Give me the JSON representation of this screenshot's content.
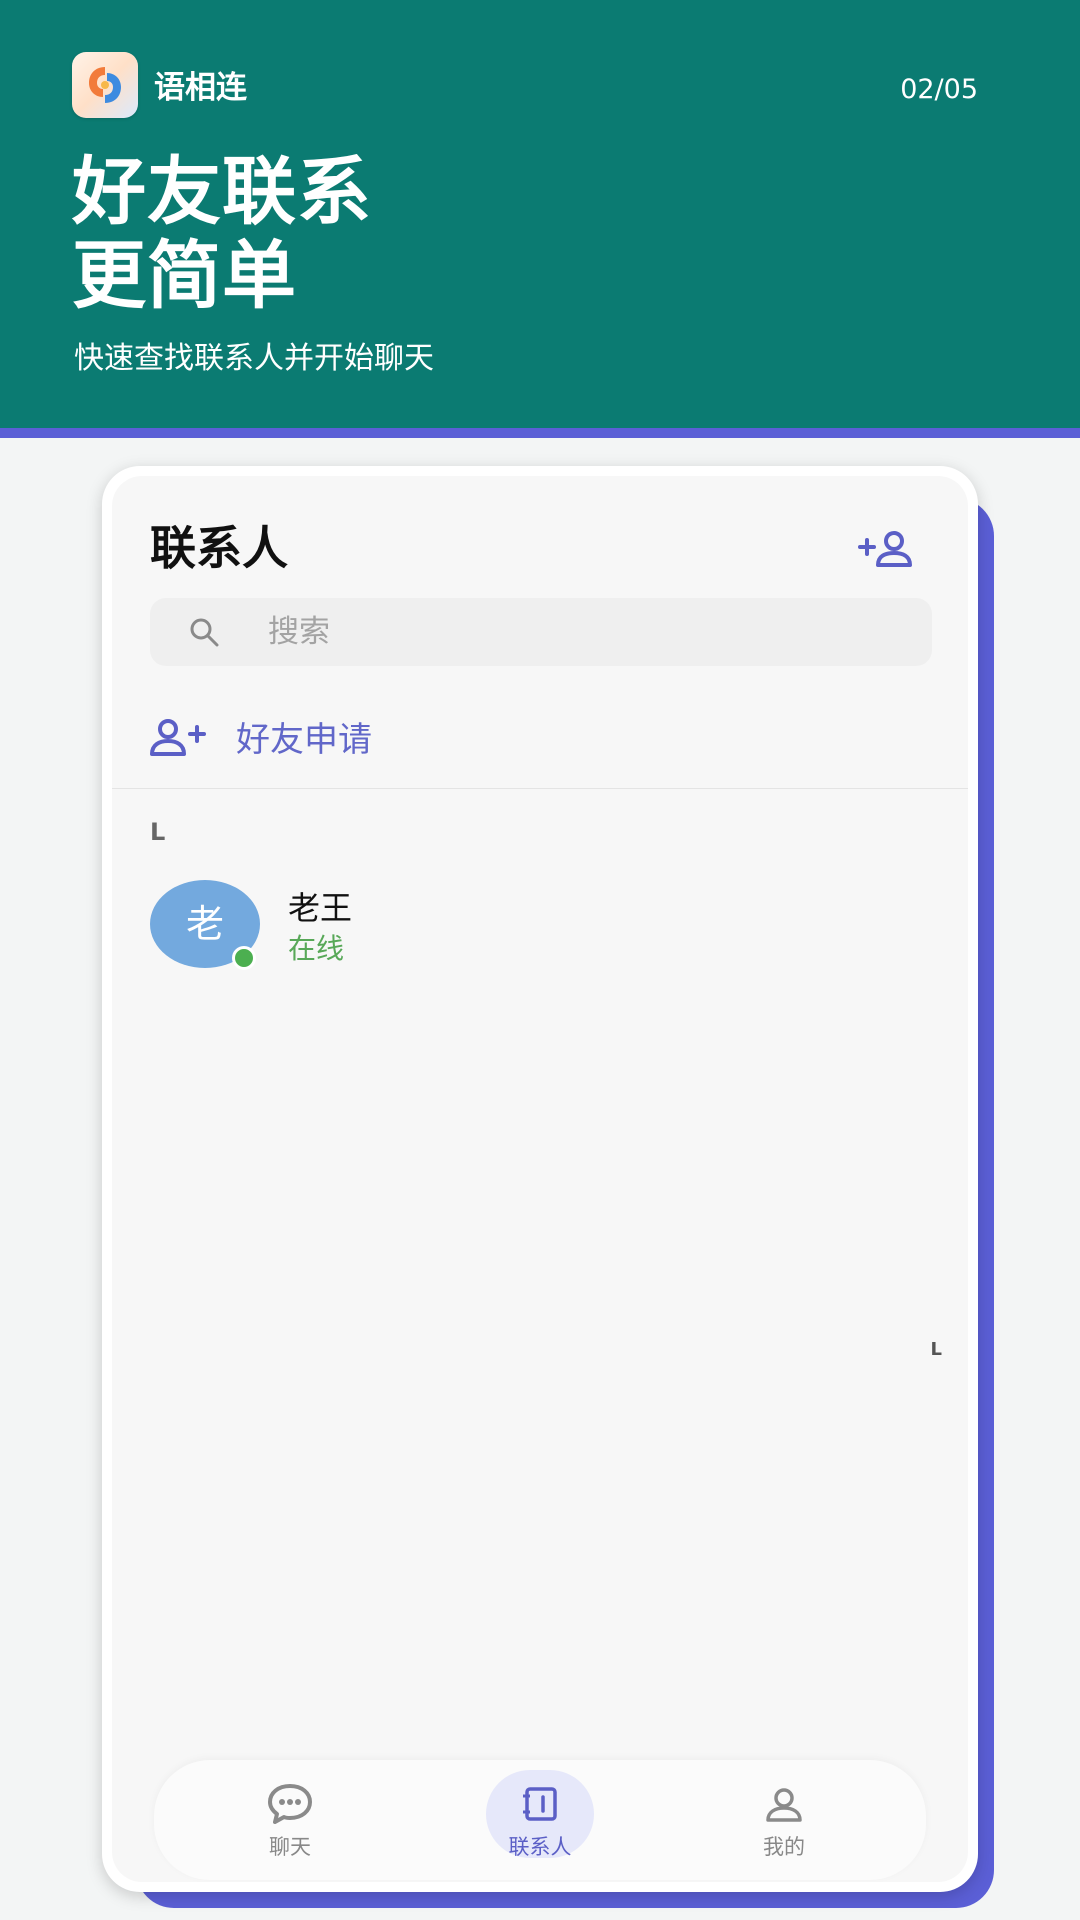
{
  "header": {
    "app_name": "语相连",
    "step": "02/05",
    "headline_line1": "好友联系",
    "headline_line2": "更简单",
    "subline": "快速查找联系人并开始聊天"
  },
  "screen": {
    "title": "联系人",
    "search": {
      "placeholder": "搜索",
      "value": ""
    },
    "friend_request_label": "好友申请",
    "sections": [
      {
        "letter": "L",
        "contacts": [
          {
            "avatar_text": "老",
            "name": "老王",
            "status": "在线"
          }
        ]
      }
    ],
    "index_letters": [
      "L"
    ]
  },
  "tabbar": {
    "active": "contacts",
    "tabs": [
      {
        "id": "chat",
        "label": "聊天",
        "icon": "chat-bubble-icon"
      },
      {
        "id": "contacts",
        "label": "联系人",
        "icon": "contacts-book-icon"
      },
      {
        "id": "me",
        "label": "我的",
        "icon": "person-icon"
      }
    ]
  },
  "colors": {
    "banner": "#0b7b72",
    "accent": "#5b5fd6",
    "online": "#4caf50",
    "avatar": "#73a9de"
  }
}
